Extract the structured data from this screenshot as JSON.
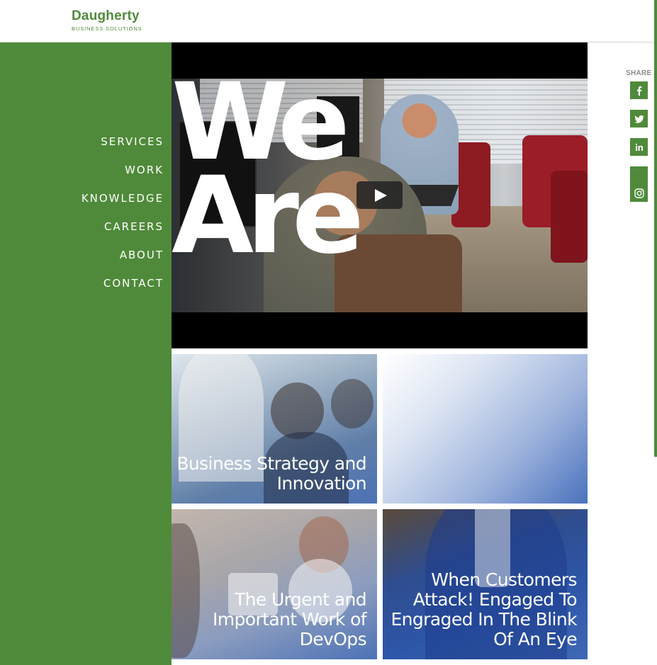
{
  "header": {
    "logo_name": "Daugherty",
    "logo_tagline": "BUSINESS SOLUTIONS"
  },
  "sidebar": {
    "items": [
      {
        "label": "SERVICES"
      },
      {
        "label": "WORK"
      },
      {
        "label": "KNOWLEDGE"
      },
      {
        "label": "CAREERS"
      },
      {
        "label": "ABOUT"
      },
      {
        "label": "CONTACT"
      }
    ]
  },
  "video": {
    "overlay_text_line1": "We",
    "overlay_text_line2": "Are",
    "play_icon": "play-icon"
  },
  "share": {
    "label": "SHARE",
    "icons": [
      "facebook-icon",
      "twitter-icon",
      "linkedin-icon",
      "instagram-icon"
    ]
  },
  "tiles": [
    {
      "title": "Business Strategy and Innovation"
    },
    {
      "title": ""
    },
    {
      "title": "The Urgent and Important Work of DevOps"
    },
    {
      "title": "When Customers Attack! Engaged To Engraged In The Blink Of An Eye"
    }
  ],
  "colors": {
    "brand_green": "#4f8a3a",
    "tile_blue": "#4a72bd"
  }
}
